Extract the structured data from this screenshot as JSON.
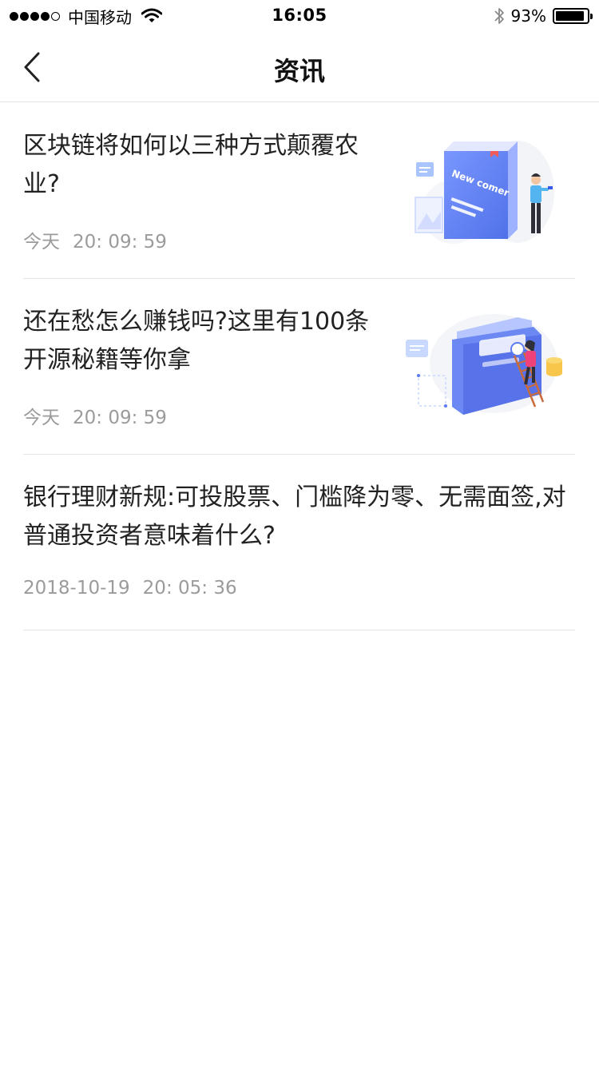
{
  "status_bar": {
    "carrier": "中国移动",
    "time": "16:05",
    "battery": "93%",
    "battery_level": 0.93,
    "signal_dots_filled": 4,
    "signal_dots_total": 5,
    "icons": [
      "signal-dots-icon",
      "wifi-icon",
      "bluetooth-icon",
      "battery-icon"
    ]
  },
  "nav": {
    "back_icon": "chevron-left-icon",
    "title": "资讯"
  },
  "news": [
    {
      "title": "区块链将如何以三种方式颠覆农业?",
      "date": "今天",
      "time": "20: 09: 59",
      "thumbnail_text": "New comer",
      "thumbnail": "book-illustration"
    },
    {
      "title": "还在愁怎么赚钱吗?这里有100条开源秘籍等你拿",
      "date": "今天",
      "time": "20: 09: 59",
      "thumbnail": "folder-ladder-illustration"
    },
    {
      "title": "银行理财新规:可投股票、门槛降为零、无需面签,对普通投资者意味着什么?",
      "date": "2018-10-19",
      "time": "20: 05: 36"
    }
  ],
  "colors": {
    "accent_blue": "#5B7BF0",
    "text_primary": "#222222",
    "text_secondary": "#9B9B9B",
    "divider": "#E6E6E6"
  }
}
